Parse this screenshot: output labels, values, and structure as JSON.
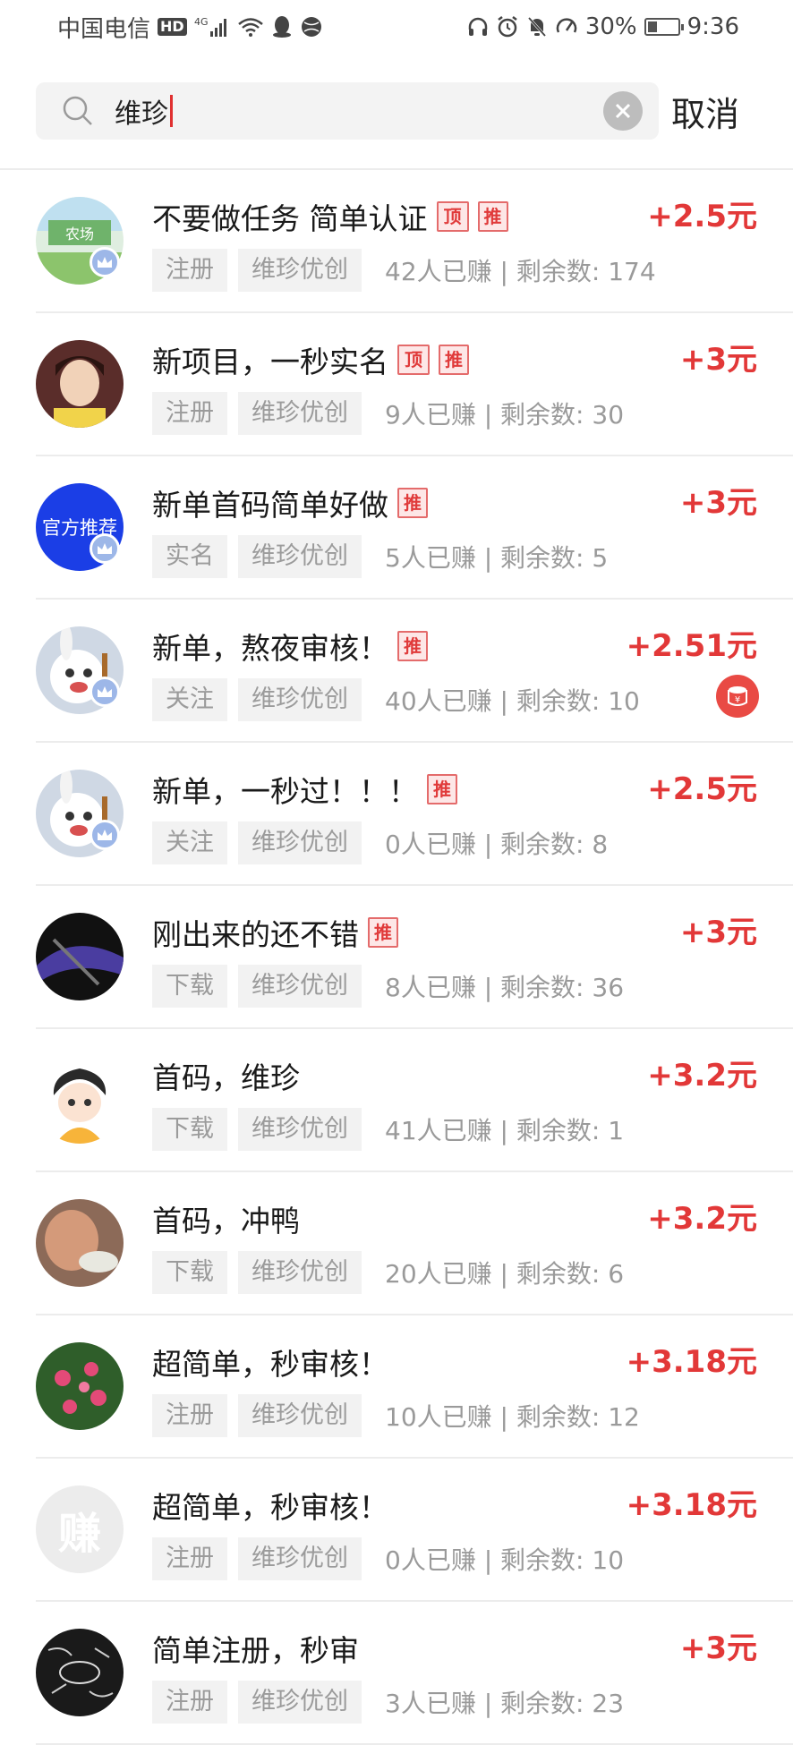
{
  "status": {
    "carrier": "中国电信",
    "hd": "HD",
    "network": "4G",
    "battery": "30%",
    "battery_level": 0.3,
    "time": "9:36"
  },
  "search": {
    "query": "维珍",
    "cancel_label": "取消"
  },
  "badges": {
    "top": "顶",
    "recommend": "推"
  },
  "items": [
    {
      "title": "不要做任务 简单认证",
      "reward": "+2.5元",
      "type": "注册",
      "source": "维珍优创",
      "stats": "42人已赚 | 剩余数: 174",
      "top": true,
      "rec": true,
      "avatar": "farm",
      "avatar_text": "",
      "vip": true
    },
    {
      "title": "新项目，一秒实名",
      "reward": "+3元",
      "type": "注册",
      "source": "维珍优创",
      "stats": "9人已赚 | 剩余数: 30",
      "top": true,
      "rec": true,
      "avatar": "girl",
      "avatar_text": "",
      "vip": false
    },
    {
      "title": "新单首码简单好做",
      "reward": "+3元",
      "type": "实名",
      "source": "维珍优创",
      "stats": "5人已赚 | 剩余数: 5",
      "top": false,
      "rec": true,
      "avatar": "blue",
      "avatar_text": "官方推荐",
      "vip": true
    },
    {
      "title": "新单，熬夜审核！",
      "reward": "+2.51元",
      "type": "关注",
      "source": "维珍优创",
      "stats": "40人已赚 | 剩余数: 10",
      "top": false,
      "rec": true,
      "avatar": "bunny",
      "avatar_text": "",
      "vip": true,
      "coin": true
    },
    {
      "title": "新单，一秒过！！！",
      "reward": "+2.5元",
      "type": "关注",
      "source": "维珍优创",
      "stats": "0人已赚 | 剩余数: 8",
      "top": false,
      "rec": true,
      "avatar": "bunny",
      "avatar_text": "",
      "vip": true
    },
    {
      "title": "刚出来的还不错",
      "reward": "+3元",
      "type": "下载",
      "source": "维珍优创",
      "stats": "8人已赚 | 剩余数: 36",
      "top": false,
      "rec": true,
      "avatar": "dark",
      "avatar_text": "",
      "vip": false
    },
    {
      "title": "首码，维珍",
      "reward": "+3.2元",
      "type": "下载",
      "source": "维珍优创",
      "stats": "41人已赚 | 剩余数: 1",
      "top": false,
      "rec": false,
      "avatar": "cartoon",
      "avatar_text": "",
      "vip": false
    },
    {
      "title": "首码，冲鸭",
      "reward": "+3.2元",
      "type": "下载",
      "source": "维珍优创",
      "stats": "20人已赚 | 剩余数: 6",
      "top": false,
      "rec": false,
      "avatar": "baby",
      "avatar_text": "",
      "vip": false
    },
    {
      "title": "超简单，秒审核！",
      "reward": "+3.18元",
      "type": "注册",
      "source": "维珍优创",
      "stats": "10人已赚 | 剩余数: 12",
      "top": false,
      "rec": false,
      "avatar": "flower",
      "avatar_text": "",
      "vip": false
    },
    {
      "title": "超简单，秒审核！",
      "reward": "+3.18元",
      "type": "注册",
      "source": "维珍优创",
      "stats": "0人已赚 | 剩余数: 10",
      "top": false,
      "rec": false,
      "avatar": "placeholder",
      "avatar_text": "赚",
      "vip": false
    },
    {
      "title": "简单注册，秒审",
      "reward": "+3元",
      "type": "注册",
      "source": "维珍优创",
      "stats": "3人已赚 | 剩余数: 23",
      "top": false,
      "rec": false,
      "avatar": "chalk",
      "avatar_text": "",
      "vip": false
    }
  ],
  "colors": {
    "accent": "#e23838",
    "badge_bg": "#fde7e7",
    "tag_bg": "#f2f2f2"
  }
}
